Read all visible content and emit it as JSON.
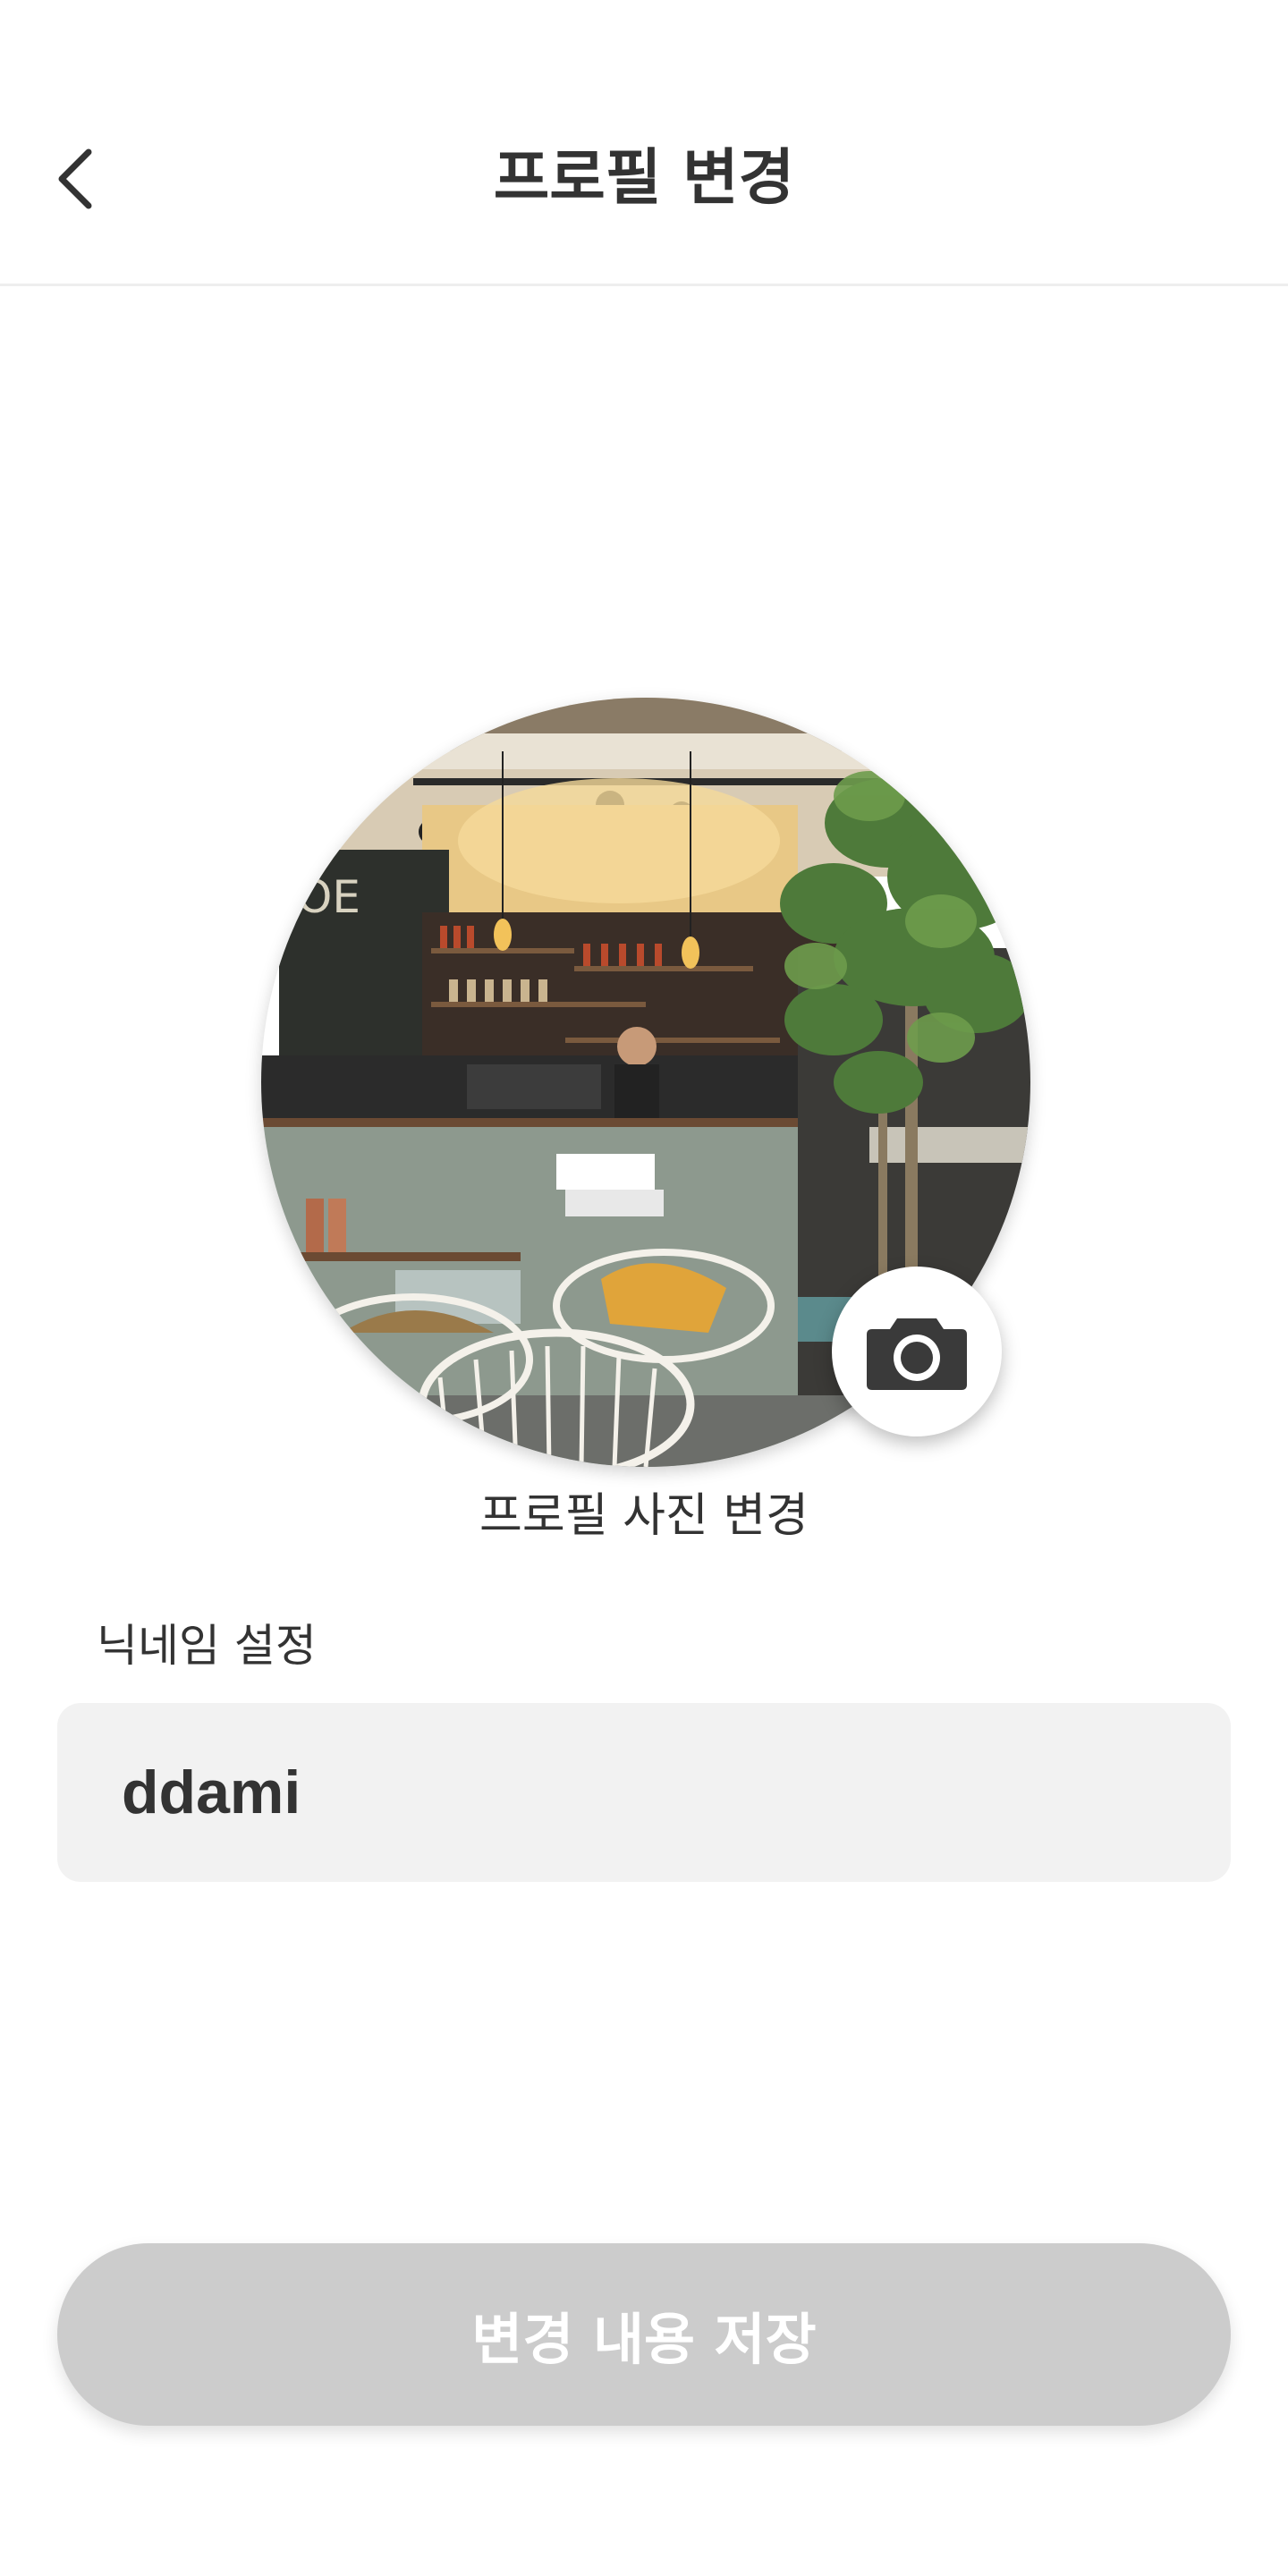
{
  "header": {
    "title": "프로필 변경",
    "back_icon": "chevron-left-icon"
  },
  "profile": {
    "photo_description_icon": "cafe-photo",
    "camera_icon": "camera-icon",
    "change_photo_label": "프로필 사진 변경"
  },
  "nickname": {
    "label": "닉네임 설정",
    "value": "ddami",
    "placeholder": ""
  },
  "actions": {
    "save_label": "변경 내용 저장",
    "save_state": "disabled"
  },
  "colors": {
    "text": "#333333",
    "input_bg": "#f2f2f2",
    "disabled_button": "#cccccc",
    "button_text": "#ffffff"
  }
}
